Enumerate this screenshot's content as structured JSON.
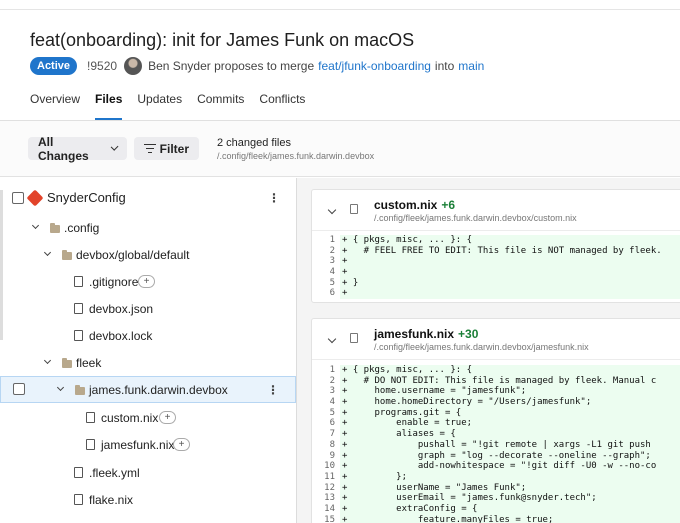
{
  "mr": {
    "title": "feat(onboarding): init for James Funk on macOS",
    "status": "Active",
    "id": "!9520",
    "author_text": "Ben Snyder proposes to merge",
    "source_branch": "feat/jfunk-onboarding",
    "into": "into",
    "target_branch": "main"
  },
  "tabs": [
    "Overview",
    "Files",
    "Updates",
    "Commits",
    "Conflicts"
  ],
  "toolbar": {
    "all_changes": "All Changes",
    "filter": "Filter",
    "changed_count": "2 changed files",
    "changed_path": "/.config/fleek/james.funk.darwin.devbox"
  },
  "tree": {
    "items": [
      {
        "label": "SnyderConfig",
        "icon": "git-repo-icon"
      },
      {
        "label": ".config",
        "icon": "folder-icon"
      },
      {
        "label": "devbox/global/default",
        "icon": "folder-icon"
      },
      {
        "label": ".gitignore",
        "icon": "file-icon"
      },
      {
        "label": "devbox.json",
        "icon": "file-icon"
      },
      {
        "label": "devbox.lock",
        "icon": "file-icon"
      },
      {
        "label": "fleek",
        "icon": "folder-icon"
      },
      {
        "label": "james.funk.darwin.devbox",
        "icon": "folder-icon"
      },
      {
        "label": "custom.nix",
        "icon": "file-icon"
      },
      {
        "label": "jamesfunk.nix",
        "icon": "file-icon"
      },
      {
        "label": ".fleek.yml",
        "icon": "yml-file-icon"
      },
      {
        "label": "flake.nix",
        "icon": "file-icon"
      }
    ],
    "plus": "+",
    "kebab": "⋮"
  },
  "diffs": [
    {
      "name": "custom.nix",
      "additions": "+6",
      "path": "/.config/fleek/james.funk.darwin.devbox/custom.nix",
      "lines": [
        {
          "n": "1",
          "t": "+ { pkgs, misc, ... }: {"
        },
        {
          "n": "2",
          "t": "+   # FEEL FREE TO EDIT: This file is NOT managed by fleek."
        },
        {
          "n": "3",
          "t": "+"
        },
        {
          "n": "4",
          "t": "+"
        },
        {
          "n": "5",
          "t": "+ }"
        },
        {
          "n": "6",
          "t": "+"
        }
      ]
    },
    {
      "name": "jamesfunk.nix",
      "additions": "+30",
      "path": "/.config/fleek/james.funk.darwin.devbox/jamesfunk.nix",
      "lines": [
        {
          "n": "1",
          "t": "+ { pkgs, misc, ... }: {"
        },
        {
          "n": "2",
          "t": "+   # DO NOT EDIT: This file is managed by fleek. Manual c"
        },
        {
          "n": "3",
          "t": "+     home.username = \"jamesfunk\";"
        },
        {
          "n": "4",
          "t": "+     home.homeDirectory = \"/Users/jamesfunk\";"
        },
        {
          "n": "5",
          "t": "+     programs.git = {"
        },
        {
          "n": "6",
          "t": "+         enable = true;"
        },
        {
          "n": "7",
          "t": "+         aliases = {"
        },
        {
          "n": "8",
          "t": "+             pushall = \"!git remote | xargs -L1 git push"
        },
        {
          "n": "9",
          "t": "+             graph = \"log --decorate --oneline --graph\";"
        },
        {
          "n": "10",
          "t": "+             add-nowhitespace = \"!git diff -U0 -w --no-co"
        },
        {
          "n": "11",
          "t": "+         };"
        },
        {
          "n": "12",
          "t": "+         userName = \"James Funk\";"
        },
        {
          "n": "13",
          "t": "+         userEmail = \"james.funk@snyder.tech\";"
        },
        {
          "n": "14",
          "t": "+         extraConfig = {"
        },
        {
          "n": "15",
          "t": "+             feature.manyFiles = true;"
        }
      ]
    }
  ]
}
